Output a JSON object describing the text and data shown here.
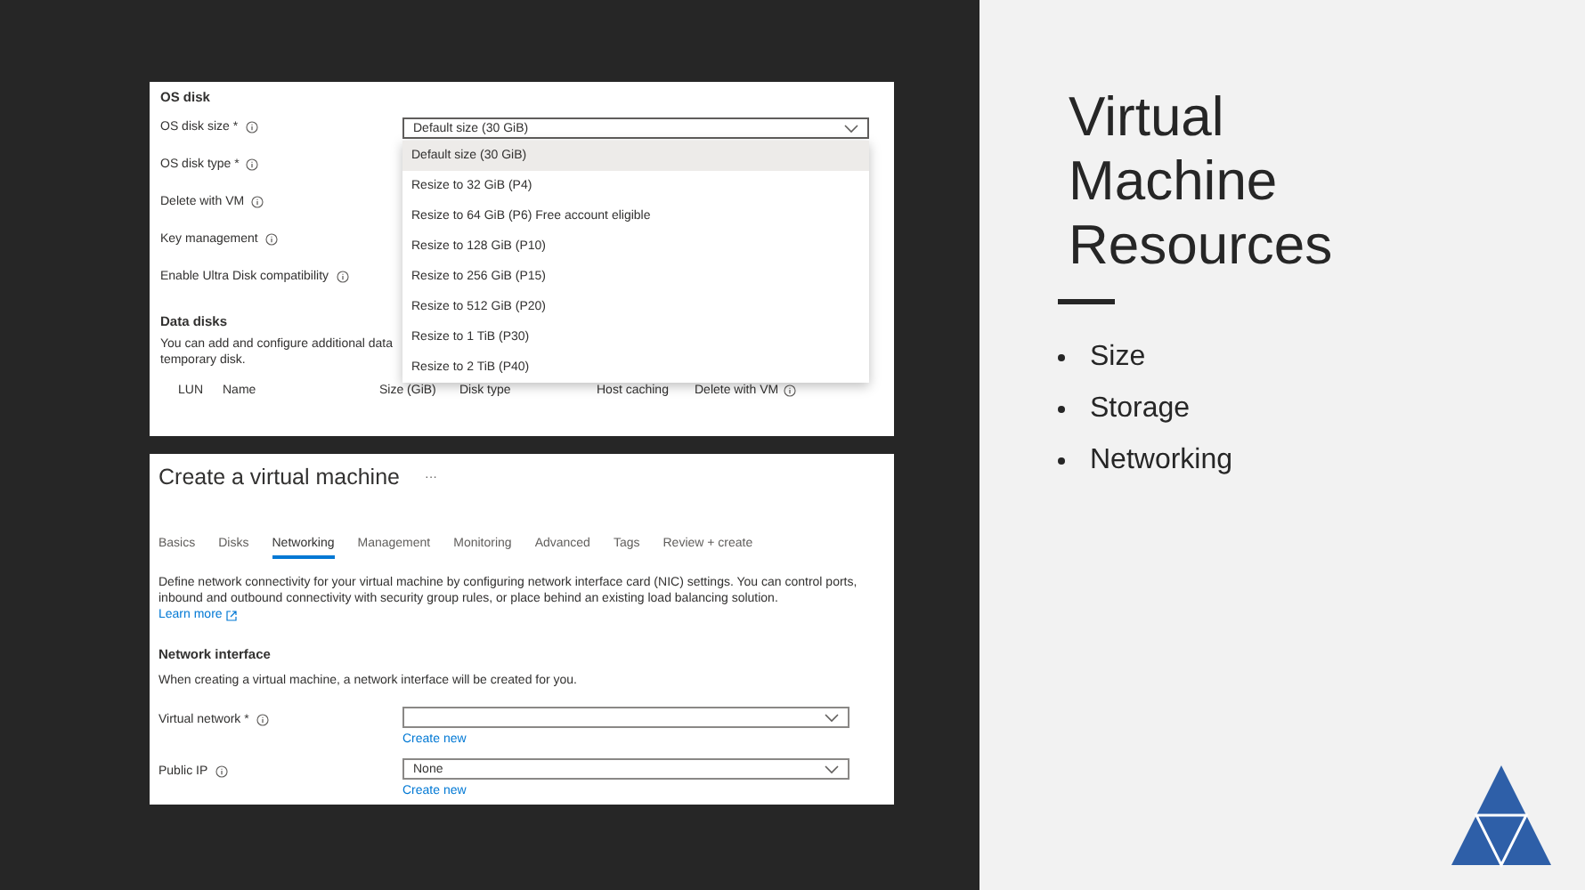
{
  "os_disk_panel": {
    "heading": "OS disk",
    "fields": [
      {
        "label": "OS disk size *",
        "info": true
      },
      {
        "label": "OS disk type *",
        "info": true
      },
      {
        "label": "Delete with VM",
        "info": true
      },
      {
        "label": "Key management",
        "info": true
      },
      {
        "label": "Enable Ultra Disk compatibility",
        "info": true
      }
    ],
    "size_dropdown": {
      "value": "Default size (30 GiB)",
      "expanded": true,
      "options": [
        {
          "label": "Default size (30 GiB)",
          "selected": true
        },
        {
          "label": "Resize to 32 GiB (P4)",
          "selected": false
        },
        {
          "label": "Resize to 64 GiB (P6) Free account eligible",
          "selected": false
        },
        {
          "label": "Resize to 128 GiB (P10)",
          "selected": false
        },
        {
          "label": "Resize to 256 GiB (P15)",
          "selected": false
        },
        {
          "label": "Resize to 512 GiB (P20)",
          "selected": false
        },
        {
          "label": "Resize to 1 TiB (P30)",
          "selected": false
        },
        {
          "label": "Resize to 2 TiB (P40)",
          "selected": false
        }
      ]
    },
    "data_disks": {
      "heading": "Data disks",
      "description_lines": [
        "You can add and configure additional data",
        "temporary disk."
      ],
      "columns": [
        {
          "label": "LUN",
          "info": false
        },
        {
          "label": "Name",
          "info": false
        },
        {
          "label": "Size (GiB)",
          "info": false
        },
        {
          "label": "Disk type",
          "info": false
        },
        {
          "label": "Host caching",
          "info": false
        },
        {
          "label": "Delete with VM",
          "info": true
        }
      ]
    }
  },
  "create_vm_panel": {
    "title": "Create a virtual machine",
    "more": "···",
    "tabs": [
      {
        "label": "Basics",
        "selected": false
      },
      {
        "label": "Disks",
        "selected": false
      },
      {
        "label": "Networking",
        "selected": true
      },
      {
        "label": "Management",
        "selected": false
      },
      {
        "label": "Monitoring",
        "selected": false
      },
      {
        "label": "Advanced",
        "selected": false
      },
      {
        "label": "Tags",
        "selected": false
      },
      {
        "label": "Review + create",
        "selected": false
      }
    ],
    "description": "Define network connectivity for your virtual machine by configuring network interface card (NIC) settings. You can control ports, inbound and outbound connectivity with security group rules, or place behind an existing load balancing solution.",
    "learn_more": "Learn more",
    "section_heading": "Network interface",
    "section_text": "When creating a virtual machine, a network interface will be created for you.",
    "fields": [
      {
        "label": "Virtual network *",
        "info": true,
        "link": "Create new"
      },
      {
        "label": "Public IP",
        "info": true,
        "value": "None",
        "link": "Create new"
      }
    ]
  },
  "slide": {
    "title": "Virtual Machine Resources",
    "bullets": [
      "Size",
      "Storage",
      "Networking"
    ]
  }
}
